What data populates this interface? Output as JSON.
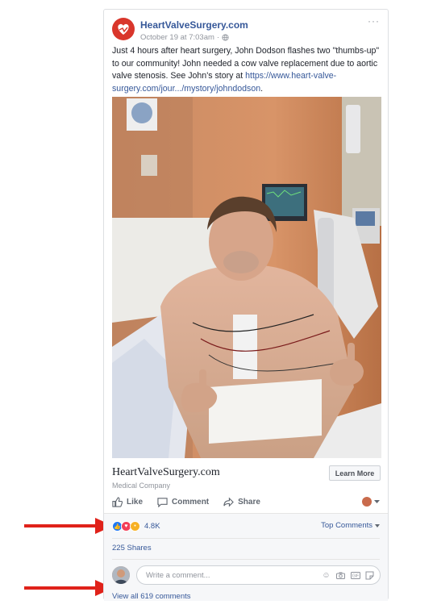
{
  "post": {
    "page_name": "HeartValveSurgery.com",
    "date": "October 19 at 7:03am",
    "separator": "·",
    "more_label": "···",
    "text_main": "Just 4 hours after heart surgery, John Dodson flashes two \"thumbs-up\" to our community! John needed a cow valve replacement due to aortic valve stenosis. See John's story at ",
    "text_link": "https://www.heart-valve-surgery.com/jour.../mystory/johndodson",
    "text_end": "."
  },
  "link_preview": {
    "title": "HeartValveSurgery.com",
    "subtitle": "Medical Company",
    "button": "Learn More"
  },
  "actions": {
    "like": "Like",
    "comment": "Comment",
    "share": "Share"
  },
  "engagement": {
    "reaction_count": "4.8K",
    "top_comments": "Top Comments",
    "shares": "225 Shares",
    "comment_placeholder": "Write a comment...",
    "view_all": "View all 619 comments"
  },
  "colors": {
    "link": "#365899",
    "arrow": "#e0221a",
    "like": "#2078f4",
    "love": "#f33e58",
    "wow": "#f7b125"
  }
}
